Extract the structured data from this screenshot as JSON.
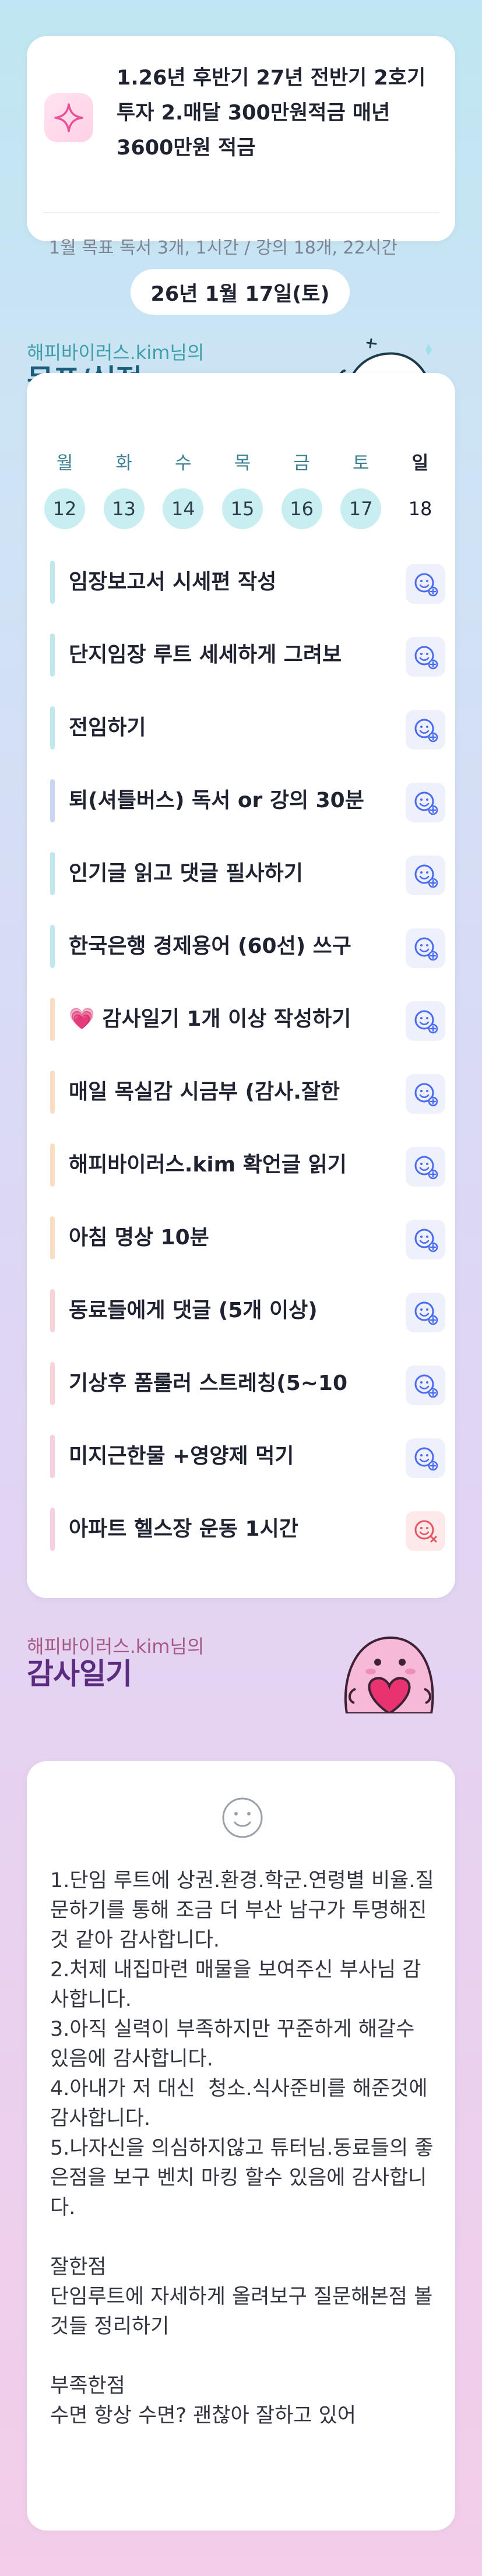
{
  "goal": {
    "text": "1.26년 후반기 27년 전반기 2호기 투자 2.매달 300만원적금 매년 3600만원 적금",
    "month_goal": "1월 목표  독서 3개, 1시간 / 강의 18개, 22시간"
  },
  "date": "26년 1월 17일(토)",
  "goals_section": {
    "user": "해피바이러스.kim님의",
    "title": "목표/실적",
    "days": [
      {
        "label": "월",
        "num": "12"
      },
      {
        "label": "화",
        "num": "13"
      },
      {
        "label": "수",
        "num": "14"
      },
      {
        "label": "목",
        "num": "15"
      },
      {
        "label": "금",
        "num": "16"
      },
      {
        "label": "토",
        "num": "17"
      },
      {
        "label": "일",
        "num": "18"
      }
    ],
    "tasks": [
      {
        "title": "임장보고서 시세편 작성",
        "color": "#bfe8ee",
        "status": "pending"
      },
      {
        "title": "단지임장 루트 세세하게 그려보",
        "color": "#bfe8ee",
        "status": "pending"
      },
      {
        "title": "전임하기",
        "color": "#bfe8ee",
        "status": "pending"
      },
      {
        "title": "퇴(셔틀버스) 독서 or 강의 30분",
        "color": "#c9d6f3",
        "status": "pending"
      },
      {
        "title": "인기글 읽고 댓글 필사하기",
        "color": "#bfe8ee",
        "status": "pending"
      },
      {
        "title": "한국은행 경제용어 (60선) 쓰구",
        "color": "#bfe8ee",
        "status": "pending"
      },
      {
        "title": "💗 감사일기 1개 이상 작성하기",
        "color": "#f9ddc1",
        "status": "pending"
      },
      {
        "title": "매일 목실감 시금부 (감사.잘한",
        "color": "#f9ddc1",
        "status": "pending"
      },
      {
        "title": "해피바이러스.kim 확언글 읽기",
        "color": "#f9ddc1",
        "status": "pending"
      },
      {
        "title": "아침 명상 10분",
        "color": "#f9ddc1",
        "status": "pending"
      },
      {
        "title": "동료들에게 댓글 (5개 이상)",
        "color": "#f8d3d8",
        "status": "pending"
      },
      {
        "title": "기상후 폼룰러 스트레칭(5~10",
        "color": "#f8d3d8",
        "status": "pending"
      },
      {
        "title": "미지근한물 +영양제 먹기",
        "color": "#f6cfe2",
        "status": "pending"
      },
      {
        "title": "아파트 헬스장 운동 1시간",
        "color": "#f6cfe2",
        "status": "fail"
      }
    ]
  },
  "gratitude_section": {
    "user": "해피바이러스.kim님의",
    "title": "감사일기",
    "body": "1.단임 루트에 상권.환경.학군.연령별 비율.질문하기를 통해 조금 더 부산 남구가 투명해진것 같아 감사합니다.\n2.처제 내집마련 매물을 보여주신 부사님 감사합니다.\n3.아직 실력이 부족하지만 꾸준하게 해갈수 있음에 감사합니다.\n4.아내가 저 대신  청소.식사준비를 해준것에 감사합니다.\n5.나자신을 의심하지않고 튜터님.동료들의 좋은점을 보구 벤치 마킹 할수 있음에 감사합니다.\n\n잘한점\n단임루트에 자세하게 올려보구 질문해본점 볼것들 정리하기\n\n부족한점\n수면 항상 수면? 괜찮아 잘하고 있어"
  },
  "colors": {
    "accent_teal": "#3f9fa9",
    "title_navy": "#1b5f7a",
    "title_purple": "#5b2c7f",
    "icon_blue": "#4a6cf0",
    "icon_red": "#e25561"
  }
}
